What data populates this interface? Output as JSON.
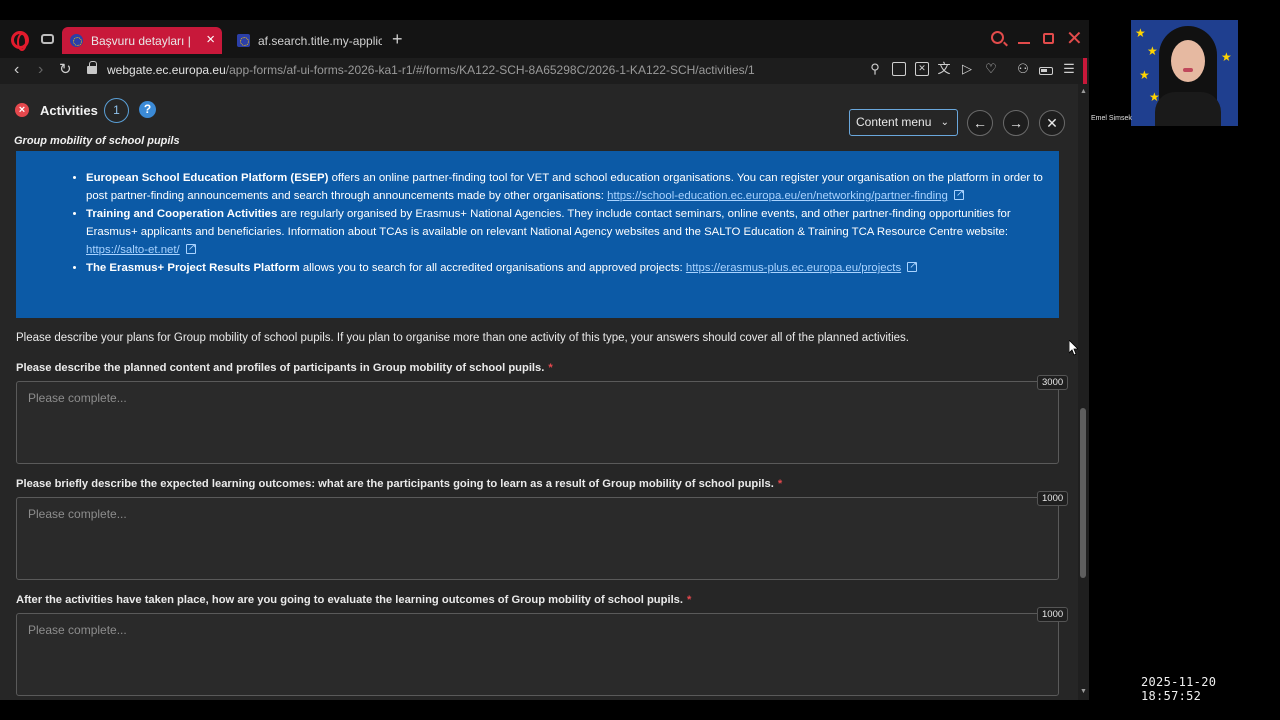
{
  "browser": {
    "tabs": [
      {
        "title": "Başvuru detayları | Er",
        "active": true
      },
      {
        "title": "af.search.title.my-applicat",
        "active": false
      }
    ],
    "new_tab": "+",
    "url_domain": "webgate.ec.europa.eu",
    "url_path": "/app-forms/af-ui-forms-2026-ka1-r1/#/forms/KA122-SCH-8A65298C/2026-1-KA122-SCH/activities/1"
  },
  "header": {
    "title": "Activities",
    "badge": "1",
    "help": "?",
    "subtitle": "Group mobility of school pupils",
    "content_menu": "Content menu"
  },
  "info": {
    "items": [
      {
        "bold": "European School Education Platform (ESEP)",
        "text": " offers an online partner-finding tool for VET and school education organisations. You can register your organisation on the platform in order to post partner-finding announcements and search through announcements made by other organisations: ",
        "link": "https://school-education.ec.europa.eu/en/networking/partner-finding"
      },
      {
        "bold": "Training and Cooperation Activities",
        "text": " are regularly organised by Erasmus+ National Agencies. They include contact seminars, online events, and other partner-finding opportunities for Erasmus+ applicants and beneficiaries. Information about TCAs is available on relevant National Agency websites and the SALTO Education & Training TCA Resource Centre website: ",
        "link": "https://salto-et.net/"
      },
      {
        "bold": "The Erasmus+ Project Results Platform",
        "text": " allows you to search for all accredited organisations and approved projects: ",
        "link": "https://erasmus-plus.ec.europa.eu/projects"
      }
    ]
  },
  "form": {
    "intro": "Please describe your plans for Group mobility of school pupils. If you plan to organise more than one activity of this type, your answers should cover all of the planned activities.",
    "required_mark": "*",
    "questions": [
      {
        "label": "Please describe the planned content and profiles of participants in Group mobility of school pupils.",
        "placeholder": "Please complete...",
        "limit": "3000"
      },
      {
        "label": "Please briefly describe the expected learning outcomes: what are the participants going to learn as a result of Group mobility of school pupils.",
        "placeholder": "Please complete...",
        "limit": "1000"
      },
      {
        "label": "After the activities have taken place, how are you going to evaluate the learning outcomes of Group mobility of school pupils.",
        "placeholder": "Please complete...",
        "limit": "1000"
      }
    ]
  },
  "video": {
    "participant_name": "Emel Simsek"
  },
  "timestamp": "2025-11-20 18:57:52",
  "colors": {
    "active_tab": "#c8183a",
    "info_box": "#0c5aa6",
    "link": "#a9d3ff",
    "required": "#e5484d",
    "accent_border": "#6aa7dc"
  },
  "icons": [
    "opera-logo-icon",
    "tabs-icon",
    "eu-flag-icon",
    "close-icon",
    "plus-icon",
    "search-icon",
    "minimize-icon",
    "maximize-icon",
    "back-icon",
    "forward-icon",
    "reload-icon",
    "lock-icon",
    "pin-icon",
    "snapshot-icon",
    "shield-icon",
    "translate-icon",
    "play-icon",
    "heart-icon",
    "account-icon",
    "battery-icon",
    "menu-icon",
    "error-icon",
    "help-icon",
    "chevron-down-icon",
    "arrow-left-icon",
    "arrow-right-icon",
    "external-link-icon"
  ]
}
